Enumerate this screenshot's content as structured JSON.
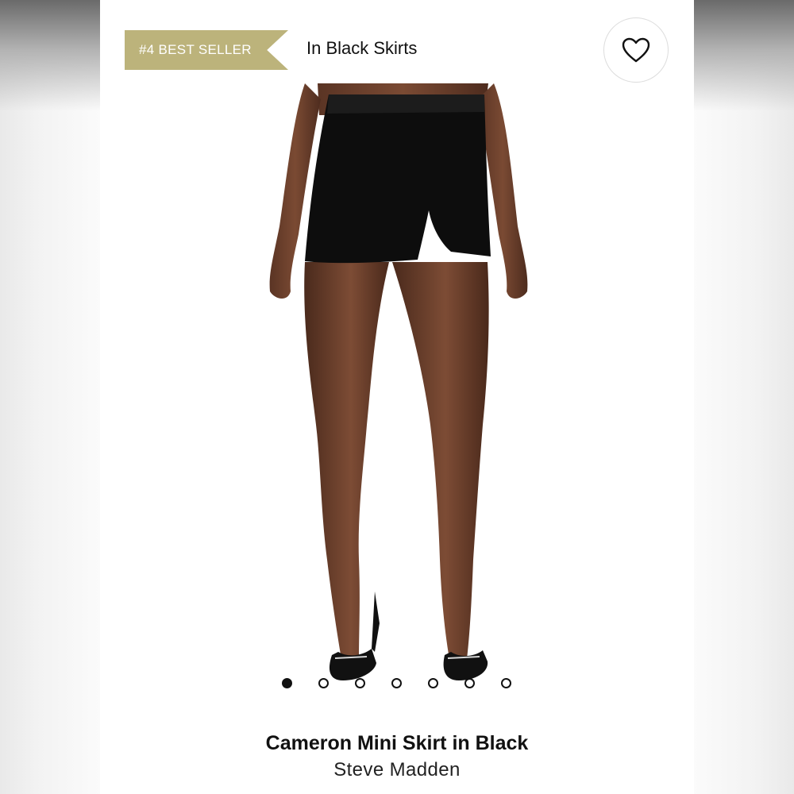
{
  "badge": {
    "text": "#4 BEST SELLER",
    "color": "#bcb37b"
  },
  "category": {
    "text": "In Black Skirts"
  },
  "favorite": {
    "icon": "heart-icon"
  },
  "gallery": {
    "image_description_icon": "product-photo",
    "dots": [
      {
        "active": true
      },
      {
        "active": false
      },
      {
        "active": false
      },
      {
        "active": false
      },
      {
        "active": false
      },
      {
        "active": false
      },
      {
        "active": false
      }
    ]
  },
  "product": {
    "title": "Cameron Mini Skirt in Black",
    "brand": "Steve Madden"
  }
}
